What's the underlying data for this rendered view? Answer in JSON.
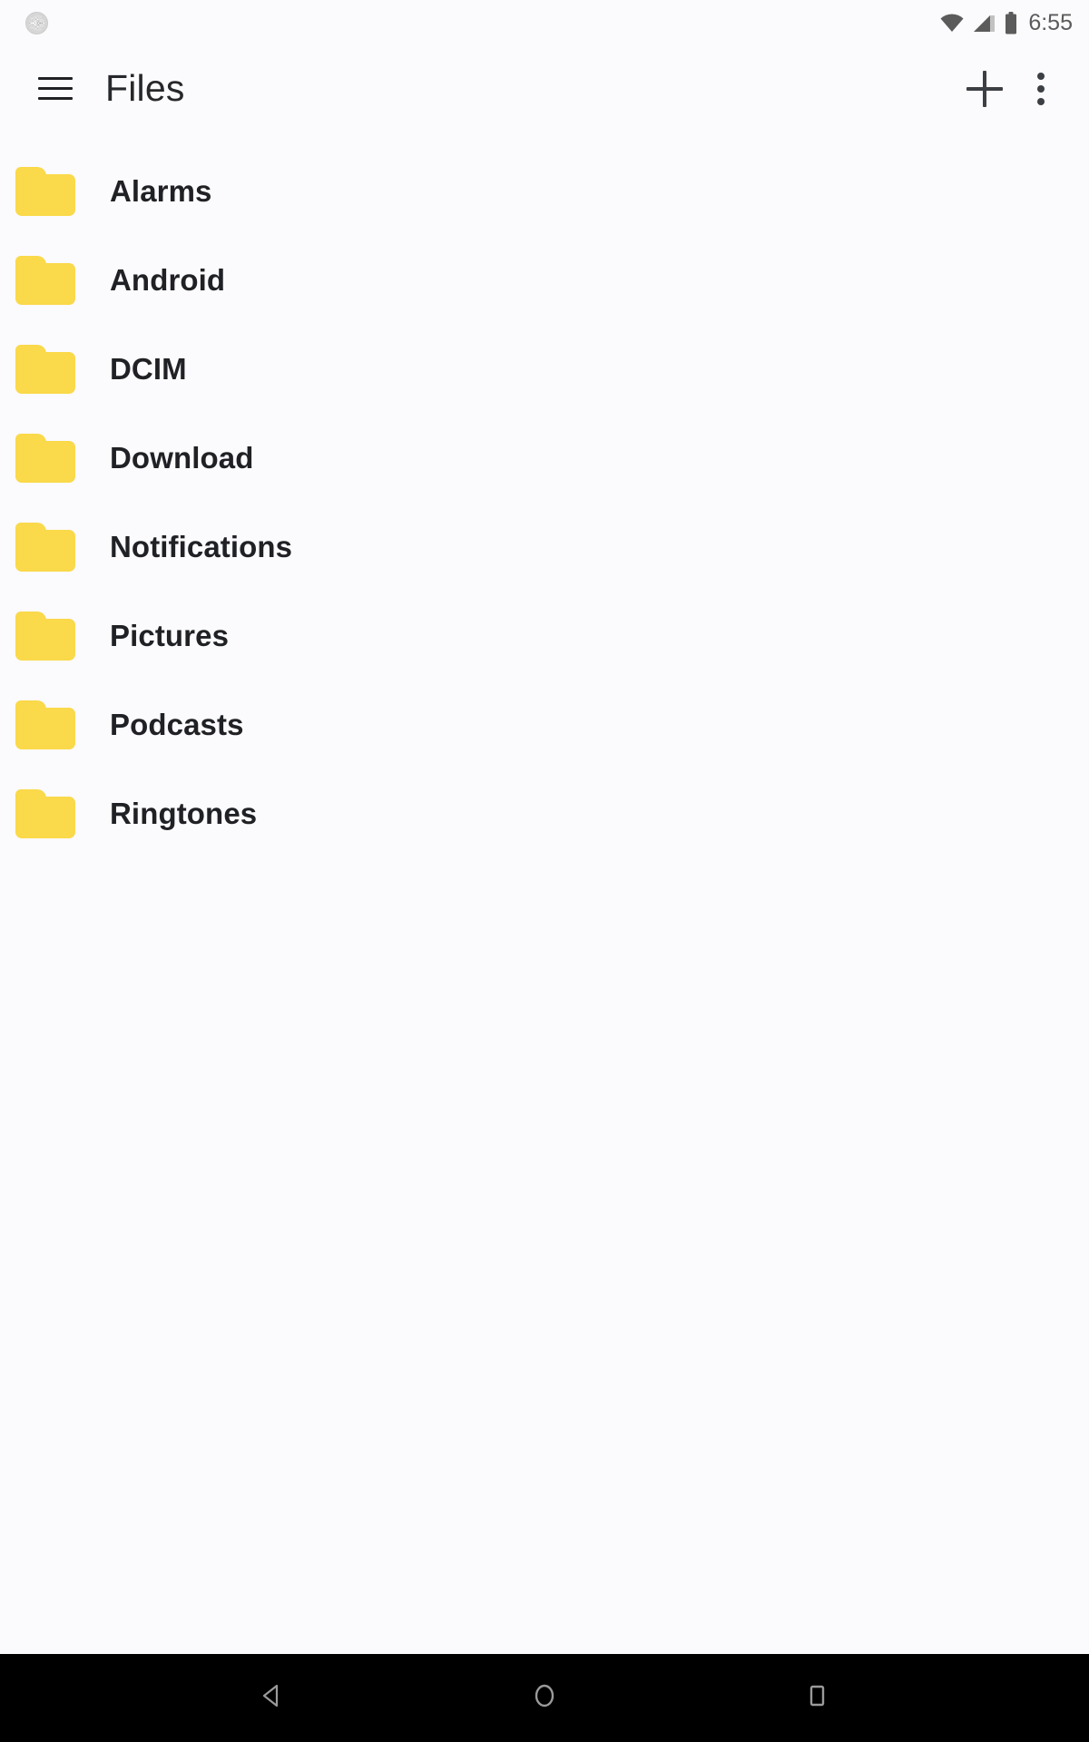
{
  "status_bar": {
    "time": "6:55",
    "left_icons": [
      {
        "name": "alarm-clock-icon",
        "glyph": "alarm"
      }
    ],
    "right_icons": [
      {
        "name": "wifi-icon",
        "glyph": "wifi"
      },
      {
        "name": "cellular-signal-icon",
        "glyph": "signal"
      },
      {
        "name": "battery-icon",
        "glyph": "battery"
      }
    ],
    "background_color": "#fbfafd",
    "text_color": "#5b5b5b"
  },
  "app_bar": {
    "title": "Files",
    "menu_icon": "hamburger-menu-icon",
    "add_icon": "plus-icon",
    "overflow_icon": "more-vertical-icon",
    "background_color": "#fbfafd",
    "title_color": "#26282b"
  },
  "file_list": {
    "icon_color": "#fad94a",
    "text_color": "#1f2124",
    "items": [
      {
        "name": "Alarms",
        "type": "folder",
        "icon": "folder-icon"
      },
      {
        "name": "Android",
        "type": "folder",
        "icon": "folder-icon"
      },
      {
        "name": "DCIM",
        "type": "folder",
        "icon": "folder-icon"
      },
      {
        "name": "Download",
        "type": "folder",
        "icon": "folder-icon"
      },
      {
        "name": "Notifications",
        "type": "folder",
        "icon": "folder-icon"
      },
      {
        "name": "Pictures",
        "type": "folder",
        "icon": "folder-icon"
      },
      {
        "name": "Podcasts",
        "type": "folder",
        "icon": "folder-icon"
      },
      {
        "name": "Ringtones",
        "type": "folder",
        "icon": "folder-icon"
      }
    ]
  },
  "nav_bar": {
    "background_color": "#000000",
    "icon_color": "#9a9a9a",
    "buttons": [
      {
        "label": "Back",
        "icon": "back-triangle-icon"
      },
      {
        "label": "Home",
        "icon": "home-circle-icon"
      },
      {
        "label": "Recents",
        "icon": "recents-square-icon"
      }
    ]
  }
}
